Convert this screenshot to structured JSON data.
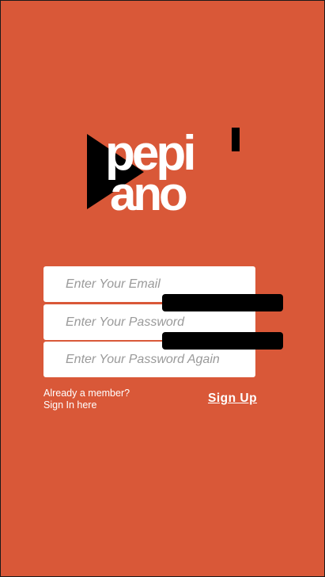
{
  "logo": {
    "line1": "pepi",
    "line2": "ano",
    "colors": {
      "text": "#FFFFFF",
      "accent": "#000000"
    }
  },
  "form": {
    "email_placeholder": "Enter Your Email",
    "password_placeholder": "Enter Your Password",
    "confirm_password_placeholder": "Enter Your Password Again"
  },
  "footer": {
    "already_member_line1": "Already a member?",
    "already_member_line2": "Sign In here",
    "signup_label": "Sign Up"
  },
  "colors": {
    "background": "#D95838",
    "input_background": "#FFFFFF",
    "redaction": "#000000"
  }
}
